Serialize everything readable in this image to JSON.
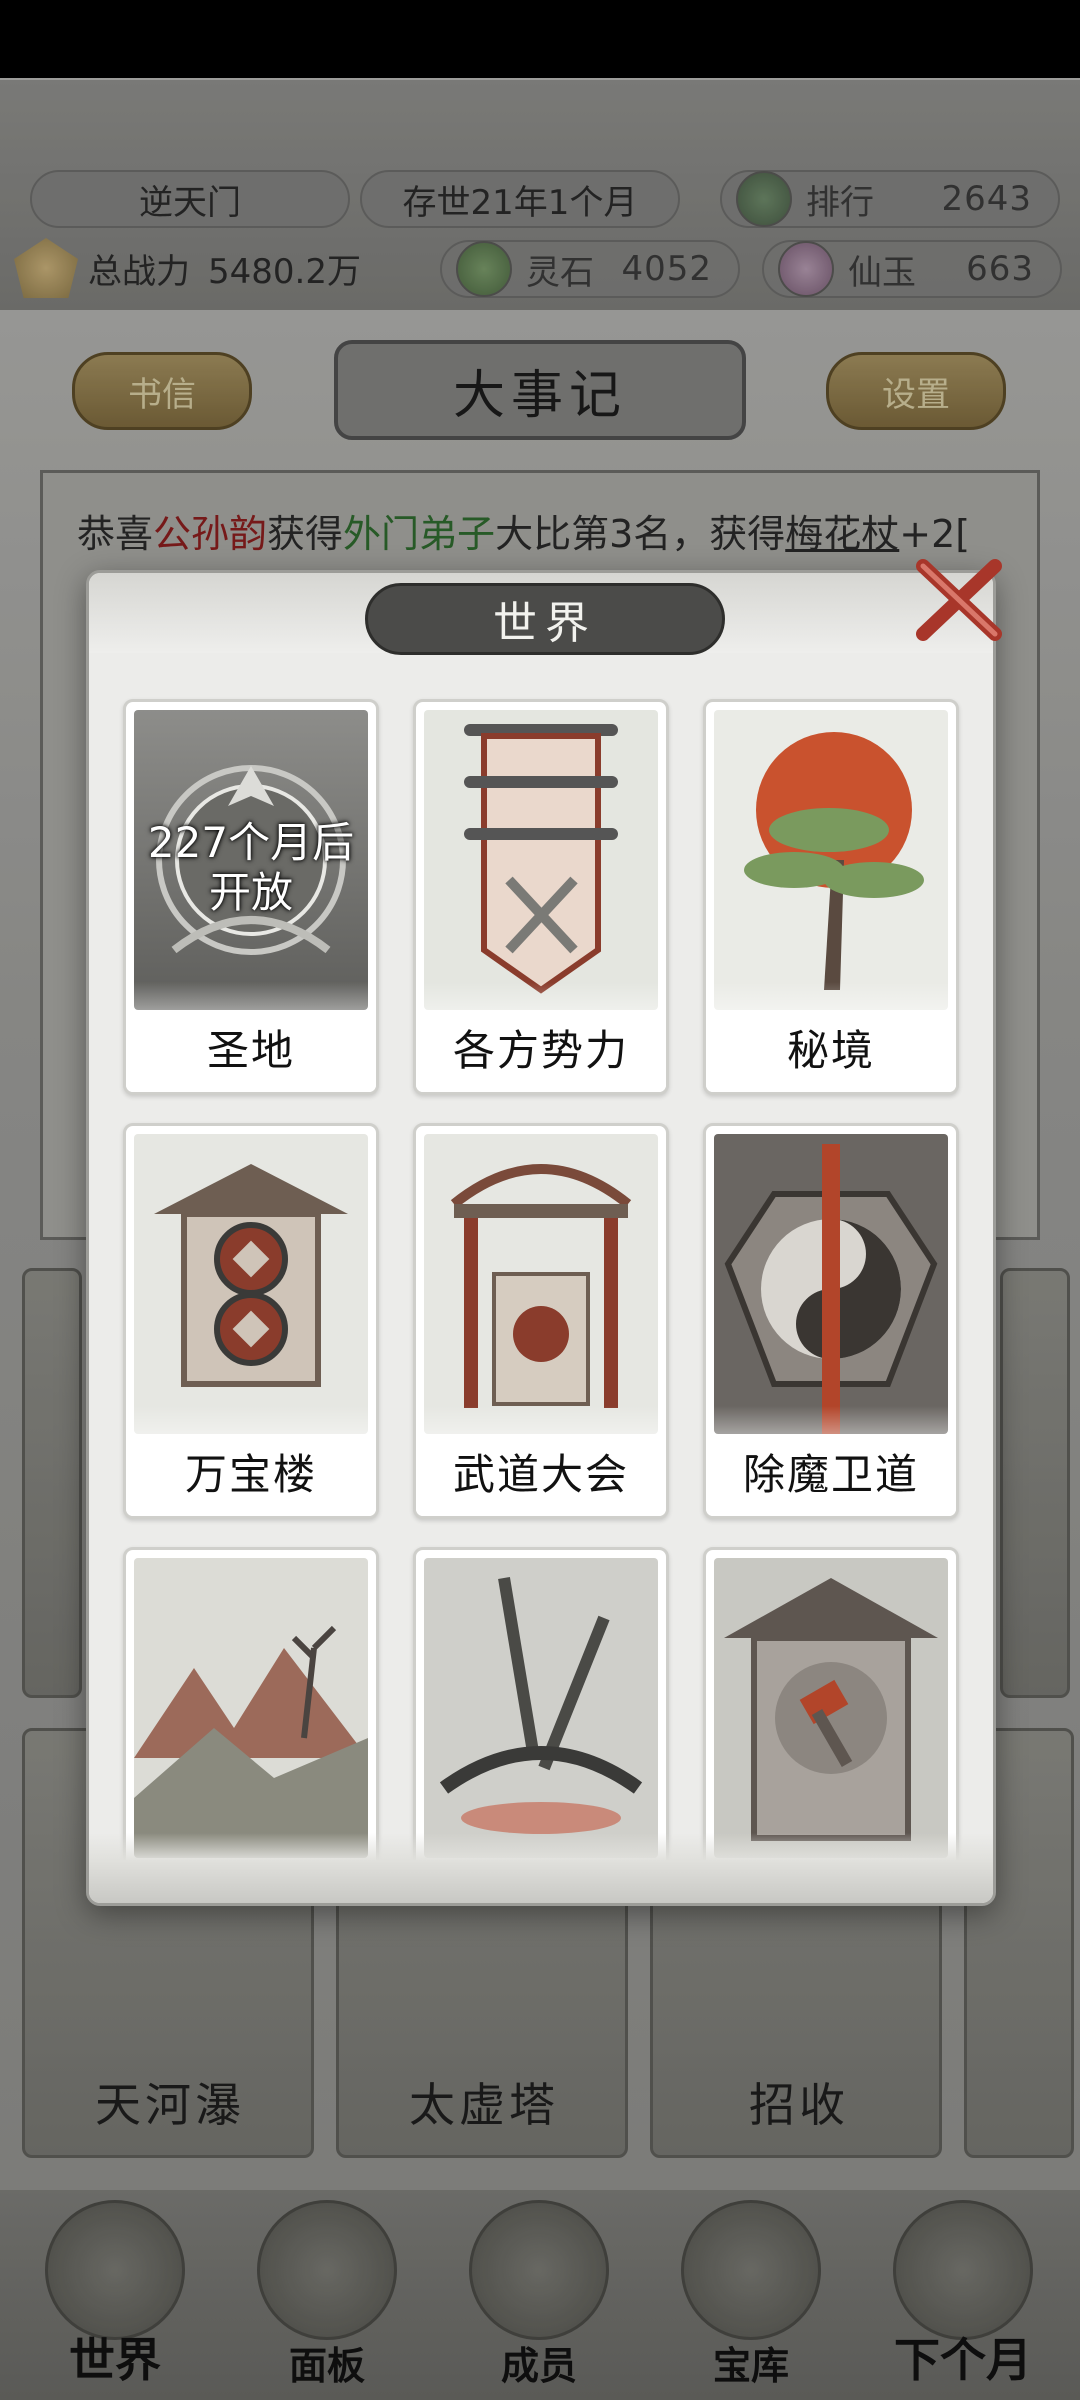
{
  "header": {
    "sect_name": "逆天门",
    "time_label": "存世21年1个月",
    "rank_label": "排行",
    "rank_value": "2643",
    "power_label": "总战力",
    "power_value": "5480.2万",
    "spirit_stone_label": "灵石",
    "spirit_stone_value": "4052",
    "jade_label": "仙玉",
    "jade_value": "663"
  },
  "nav": {
    "letters_label": "书信",
    "chronicle_label": "大事记",
    "settings_label": "设置"
  },
  "chronicle": {
    "lines": [
      {
        "parts": [
          "恭喜",
          "公孙韵",
          "获得",
          "外门弟子",
          "大比第3名，获得",
          "梅花杖",
          "+2["
        ]
      }
    ]
  },
  "background_cards": [
    "天河瀑",
    "太虚塔",
    "招收"
  ],
  "bottom_nav": [
    "世界",
    "面板",
    "成员",
    "宝库",
    "下个月"
  ],
  "modal": {
    "title": "世界",
    "cards": [
      {
        "label": "圣地",
        "locked_line1": "227个月后",
        "locked_line2": "开放"
      },
      {
        "label": "各方势力"
      },
      {
        "label": "秘境"
      },
      {
        "label": "万宝楼"
      },
      {
        "label": "武道大会"
      },
      {
        "label": "除魔卫道"
      },
      {
        "label": ""
      },
      {
        "label": ""
      },
      {
        "label": ""
      }
    ]
  }
}
